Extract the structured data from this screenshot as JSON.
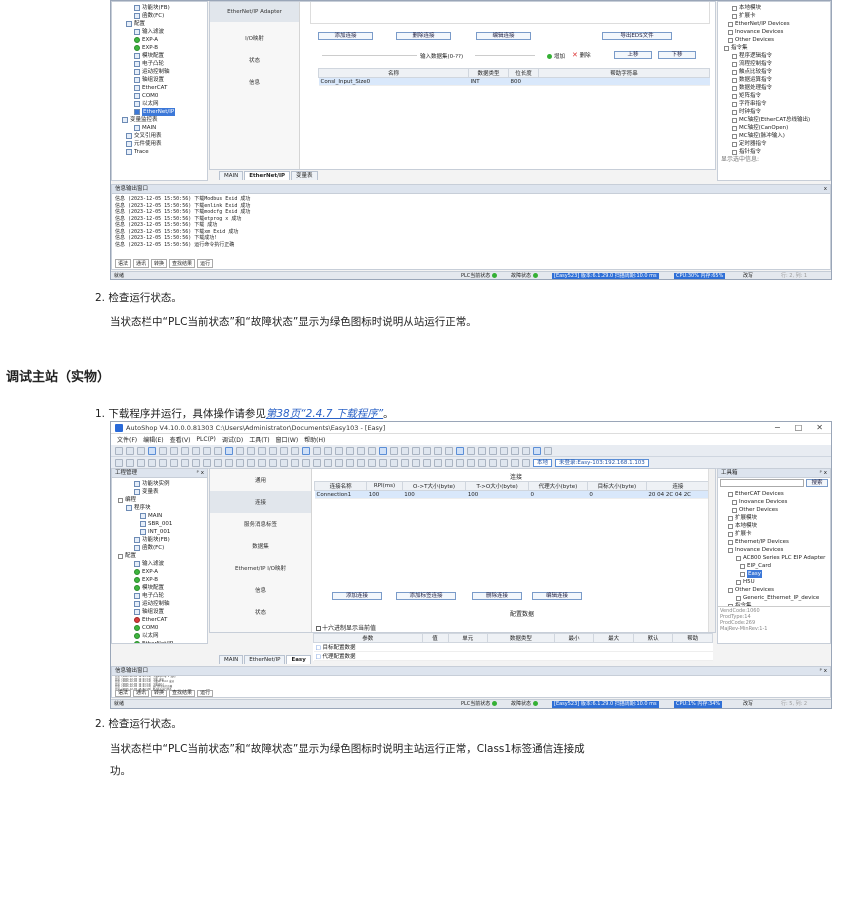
{
  "s1": {
    "tree": [
      "功能块(FB)",
      "函数(FC)",
      "配置",
      "输入滤波",
      "EXP-A",
      "EXP-B",
      "模块配置",
      "电子凸轮",
      "运动控制轴",
      "轴组设置",
      "EtherCAT",
      "COM0",
      "以太网",
      "EtherNet/IP",
      "变量监控表",
      "MAIN",
      "交叉引用表",
      "元件使用表",
      "Trace"
    ],
    "nav": [
      "EtherNet/IP Adapter",
      "I/O映射",
      "状态",
      "信息"
    ],
    "buttons": {
      "add": "添加连接",
      "del": "删除连接",
      "edit": "编辑连接",
      "export": "导出EDS文件",
      "up": "上移",
      "down": "下移"
    },
    "input_label": "输入数据集(0-??)",
    "legend": {
      "add": "增加",
      "del": "删除"
    },
    "table_headers": [
      "名称",
      "数据类型",
      "位长度",
      "帮助字符串"
    ],
    "row": [
      "Consl_Input_Size0",
      "INT",
      "800",
      ""
    ],
    "right_tree": [
      "本地模块",
      "扩展卡",
      "EtherNet/IP Devices",
      "Inovance Devices",
      "Other Devices",
      "指令集",
      "程序逻辑指令",
      "流程控制指令",
      "触点比较指令",
      "数据运算指令",
      "数据处理指令",
      "矩阵指令",
      "字符串指令",
      "时钟指令",
      "MC轴控(EtherCAT总线输出)",
      "MC轴控(CanOpen)",
      "MC轴控(脉冲输入)",
      "定时器指令",
      "指针指令"
    ],
    "right_hint": "显示选中信息:",
    "tabs": [
      "MAIN",
      "EtherNet/IP",
      "变量表"
    ],
    "log_title": "信息输出窗口",
    "logs": [
      "信息  (2023-12-05 15:50:56)  下载Modbus Exid 成功",
      "信息  (2023-12-05 15:50:56)  下载enlink Exid 成功",
      "信息  (2023-12-05 15:50:56)  下载modcfg Exid 成功",
      "信息  (2023-12-05 15:50:56)  下载etprog x 成功",
      "信息  (2023-12-05 15:50:56)  下载 成功",
      "信息  (2023-12-05 15:50:56)  下载xm Exid 成功",
      "信息  (2023-12-05 15:50:56)  下载成功!",
      "信息  (2023-12-05 15:50:56)  运行命令执行正确"
    ],
    "log_tabs": [
      "语法",
      "通讯",
      "转换",
      "查找结果",
      "运行"
    ],
    "status": {
      "left": "就绪",
      "plc": "PLC当前状态",
      "fault": "故障状态",
      "ver": "[Easy523] 版本:6.1.29.0 扫描周期:10.0 ms",
      "cpu": "CPU:30%  内存:65%",
      "mode": "改写",
      "pos": "行: 2, 列: 1"
    }
  },
  "doc": {
    "step2a": "2. 检查运行状态。",
    "para_a": "当状态栏中“PLC当前状态”和“故障状态”显示为绿色图标时说明从站运行正常。",
    "heading": "调试主站（实物）",
    "step1_pre": "1. 下载程序并运行，具体操作请参见",
    "step1_link": "第38页“2.4.7 下载程序”",
    "step1_post": "。",
    "step2b": "2. 检查运行状态。",
    "para_b1": "当状态栏中“PLC当前状态”和“故障状态”显示为绿色图标时说明主站运行正常，Class1标签通信连接成",
    "para_b2": "功。"
  },
  "s2": {
    "title": "AutoShop V4.10.0.0.81303  C:\\Users\\Administrator\\Documents\\Easy103 - [Easy]",
    "menu": [
      "文件(F)",
      "编辑(E)",
      "查看(V)",
      "PLC(P)",
      "调试(D)",
      "工具(T)",
      "窗口(W)",
      "帮助(H)"
    ],
    "local_btn": "本地",
    "ip_btn": "未登录:Easy-103:192.168.1.103",
    "proj_title": "工程管理",
    "tree": [
      "功能块实例",
      "变量表",
      "编程",
      "程序块",
      "MAIN",
      "SBR_001",
      "INT_001",
      "功能块(FB)",
      "函数(FC)",
      "配置",
      "输入滤波",
      "EXP-A",
      "EXP-B",
      "模块配置",
      "电子凸轮",
      "运动控制轴",
      "轴组设置",
      "EtherCAT",
      "COM0",
      "以太网",
      "EtherNet/IP",
      "Easy",
      "变量监控表",
      "MAIN",
      "交叉引用表"
    ],
    "nav": [
      "通用",
      "连接",
      "服务消息标签",
      "数据集",
      "Ethernet/IP I/O映射",
      "信息",
      "状态"
    ],
    "conn_header": "连接",
    "table_headers": [
      "连接名称",
      "RPI(ms)",
      "O->T大小(byte)",
      "T->O大小(byte)",
      "代理大小(byte)",
      "目标大小(byte)",
      "连接"
    ],
    "row": [
      "Connection1",
      "100",
      "100",
      "100",
      "0",
      "0",
      "20 04 2C 04 2C"
    ],
    "buttons": {
      "add": "添加连接",
      "add_tag": "添加标签连接",
      "del": "删除连接",
      "edit": "编辑连接"
    },
    "config_label": "配置数据",
    "hex_label": "十六进制显示当前值",
    "param_headers": [
      "参数",
      "值",
      "单元",
      "数据类型",
      "最小",
      "最大",
      "默认",
      "帮助"
    ],
    "params": [
      "目标配置数据",
      "代理配置数据"
    ],
    "tool_title": "工具箱",
    "search_btn": "搜索",
    "right_tree": [
      "EtherCAT Devices",
      "Inovance Devices",
      "Other Devices",
      "扩展模块",
      "本地模块",
      "扩展卡",
      "Ethernet/IP Devices",
      "Inovance Devices",
      "AC800 Series PLC EIP Adapter",
      "EIP_Card",
      "Easy",
      "H5U",
      "Other Devices",
      "Generic_Ethernet_IP_device",
      "指令集",
      "程序逻辑指令",
      "流程控制指令",
      "触点比较指令",
      "数据运算指令",
      "数据处理指令",
      "矩阵指令",
      "字符串指令",
      "时钟指令",
      "MC轴控(EtherCAT总线输出)"
    ],
    "right_info": [
      "VendCode:1060",
      "ProdType:14",
      "ProdCode:269",
      "MajRev-MinRev:1-1"
    ],
    "tabs": [
      "MAIN",
      "EtherNet/IP",
      "Easy"
    ],
    "log_title": "信息输出窗口",
    "logs": [
      "信息  (2023-12-05 14:41:12)  下载etprog x 成功",
      "信息  (2023-12-05 14:41:12)  下载 成功",
      "信息  (2023-12-05 14:41:12)  下载xm Exid 成功",
      "信息  (2023-12-05 14:41:12)  下载成功!",
      "信息  (2023-12-05 14:41:15)  运行命令执行正确",
      "信息  (2023-12-05 15:51:26)  PLC处于运行状态"
    ],
    "log_tabs": [
      "语法",
      "通讯",
      "转换",
      "查找结果",
      "运行"
    ],
    "status": {
      "left": "就绪",
      "plc": "PLC当前状态",
      "fault": "故障状态",
      "ver": "[Easy523] 版本:6.1.29.0 扫描周期:10.0 ms",
      "cpu": "CPU:1%  内存:34%",
      "mode": "改写",
      "pos": "行: 5, 列: 2"
    }
  }
}
